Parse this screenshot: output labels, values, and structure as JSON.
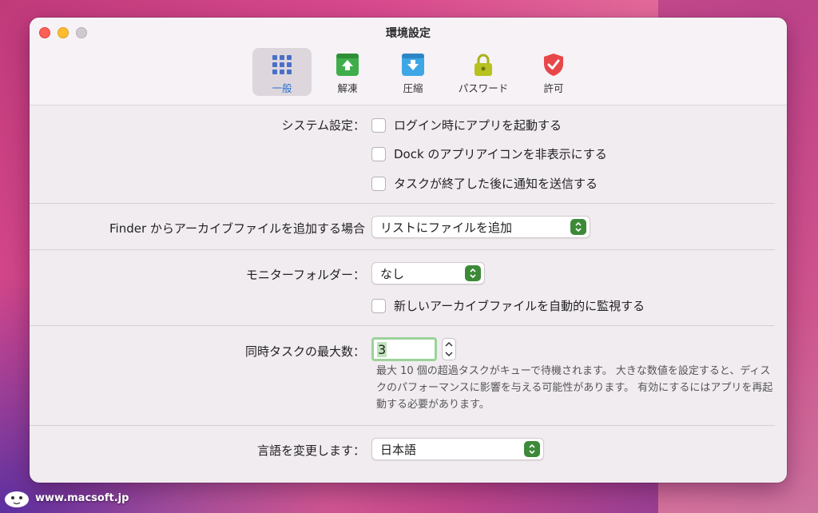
{
  "window": {
    "title": "環境設定"
  },
  "toolbar": {
    "items": [
      {
        "label": "一般",
        "icon": "grid-icon",
        "active": true
      },
      {
        "label": "解凍",
        "icon": "extract-icon"
      },
      {
        "label": "圧縮",
        "icon": "compress-icon"
      },
      {
        "label": "パスワード",
        "icon": "lock-icon"
      },
      {
        "label": "許可",
        "icon": "shield-check-icon"
      }
    ]
  },
  "system": {
    "label": "システム設定：",
    "options": [
      {
        "label": "ログイン時にアプリを起動する",
        "checked": false
      },
      {
        "label": "Dock のアプリアイコンを非表示にする",
        "checked": false
      },
      {
        "label": "タスクが終了した後に通知を送信する",
        "checked": false
      }
    ]
  },
  "finder": {
    "label": "Finder からアーカイブファイルを追加する場合",
    "value": "リストにファイルを追加"
  },
  "monitor": {
    "label": "モニターフォルダー：",
    "value": "なし",
    "auto_label": "新しいアーカイブファイルを自動的に監視する",
    "auto_checked": false
  },
  "tasks": {
    "label": "同時タスクの最大数：",
    "value": "3",
    "help": "最大 10 個の超過タスクがキューで待機されます。 大きな数値を設定すると、ディスクのパフォーマンスに影響を与える可能性があります。 有効にするにはアプリを再起動する必要があります。"
  },
  "language": {
    "label": "言語を変更します：",
    "value": "日本語"
  },
  "watermark": {
    "text": "www.macsoft.jp"
  },
  "colors": {
    "accent_green": "#3c8a38",
    "active_blue": "#2a6fd4"
  }
}
